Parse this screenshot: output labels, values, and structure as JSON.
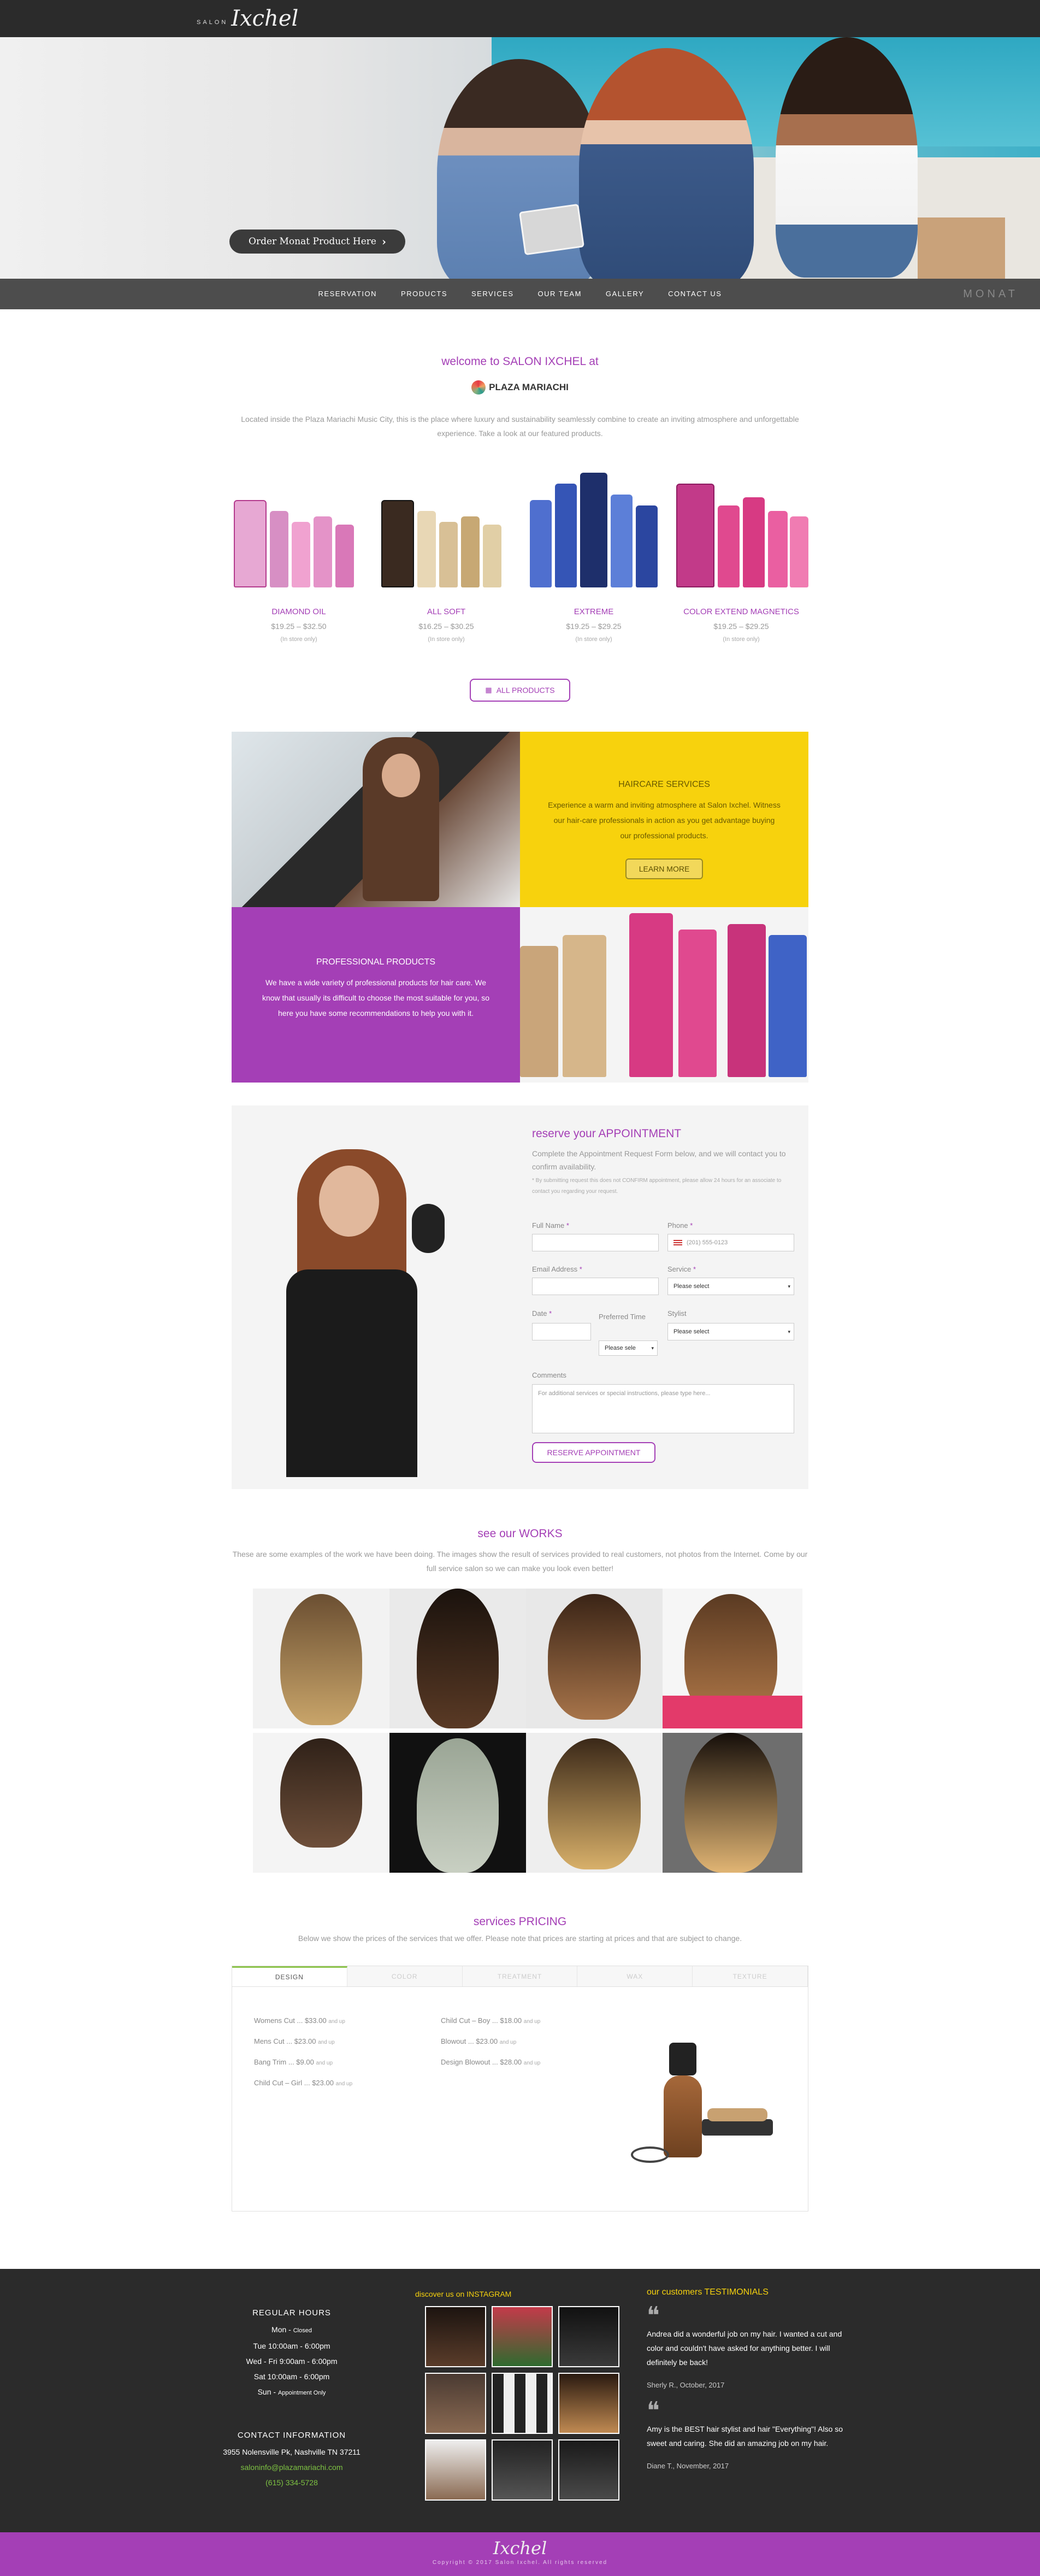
{
  "header": {
    "logo_small": "SALON",
    "logo_big": "Ixchel"
  },
  "hero": {
    "order_button": "Order Monat Product Here",
    "chevron": "›"
  },
  "nav": {
    "items": [
      "RESERVATION",
      "PRODUCTS",
      "SERVICES",
      "OUR TEAM",
      "GALLERY",
      "CONTACT US"
    ],
    "brand": "MONAT"
  },
  "welcome": {
    "title": "welcome to SALON IXCHEL at",
    "plaza": "PLAZA MARIACHI",
    "text": "Located inside the Plaza Mariachi Music City, this is the place where luxury and sustainability seamlessly combine to create an inviting atmosphere and unforgettable experience. Take a look at our featured products."
  },
  "products": [
    {
      "name": "DIAMOND OIL",
      "price": "$19.25 – $32.50",
      "note": "(In store only)"
    },
    {
      "name": "ALL SOFT",
      "price": "$16.25 – $30.25",
      "note": "(In store only)"
    },
    {
      "name": "EXTREME",
      "price": "$19.25 – $29.25",
      "note": "(In store only)"
    },
    {
      "name": "COLOR EXTEND MAGNETICS",
      "price": "$19.25 – $29.25",
      "note": "(In store only)"
    }
  ],
  "all_products_button": "ALL PRODUCTS",
  "haircare": {
    "title": "HAIRCARE SERVICES",
    "text": "Experience a warm and inviting atmosphere at Salon Ixchel. Witness our hair-care professionals in action as you get advantage buying our professional products.",
    "button": "LEARN MORE"
  },
  "professional": {
    "title": "PROFESSIONAL PRODUCTS",
    "text": "We have a wide variety of professional products for hair care. We know that usually its difficult to choose the most suitable for you, so here you have some recommendations to help you with it."
  },
  "reservation": {
    "title": "reserve your APPOINTMENT",
    "intro": "Complete the Appointment Request Form below, and we will contact you to confirm availability.",
    "fine": "* By submitting request this does not CONFIRM appointment, please allow 24 hours for an associate to contact you regarding your request.",
    "full_name_label": "Full Name",
    "phone_label": "Phone",
    "phone_placeholder": "(201) 555-0123",
    "email_label": "Email Address",
    "service_label": "Service",
    "service_value": "Please select",
    "date_label": "Date",
    "preferred_time_label": "Preferred Time",
    "time_value": "Please sele",
    "stylist_label": "Stylist",
    "stylist_value": "Please select",
    "comments_label": "Comments",
    "comments_placeholder": "For additional services or special instructions, please type here...",
    "submit": "RESERVE APPOINTMENT",
    "required_mark": "*"
  },
  "works": {
    "title": "see our WORKS",
    "text": "These are some examples of the work we have been doing. The images show the result of services provided to real customers, not photos from the Internet. Come by our full service salon so we can make you look even better!"
  },
  "pricing": {
    "title": "services PRICING",
    "subtitle": "Below we show the prices of the services that we offer. Please note that prices are starting at prices and that are subject to change.",
    "tabs": [
      "DESIGN",
      "COLOR",
      "TREATMENT",
      "WAX",
      "TEXTURE"
    ],
    "col1": [
      {
        "text": "Womens Cut ... $33.00",
        "suffix": "and up"
      },
      {
        "text": "Mens Cut ... $23.00",
        "suffix": "and up"
      },
      {
        "text": "Bang Trim ... $9.00",
        "suffix": "and up"
      },
      {
        "text": "Child Cut – Girl ... $23.00",
        "suffix": "and up"
      }
    ],
    "col2": [
      {
        "text": "Child Cut – Boy ... $18.00",
        "suffix": "and up"
      },
      {
        "text": "Blowout ... $23.00",
        "suffix": "and up"
      },
      {
        "text": "Design Blowout ... $28.00",
        "suffix": "and up"
      }
    ]
  },
  "footer": {
    "hours_title": "REGULAR HOURS",
    "hours": [
      {
        "day": "Mon -",
        "time": "Closed"
      },
      {
        "day": "Tue",
        "time": "10:00am - 6:00pm"
      },
      {
        "day": "Wed - Fri",
        "time": "9:00am - 6:00pm"
      },
      {
        "day": "Sat",
        "time": "10:00am - 6:00pm"
      },
      {
        "day": "Sun -",
        "time": "Appointment Only"
      }
    ],
    "contact_title": "CONTACT INFORMATION",
    "address": "3955 Nolensville Pk, Nashville TN 37211",
    "email": "saloninfo@plazamariachi.com",
    "phone": "(615) 334-5728",
    "instagram_title": "discover us on INSTAGRAM",
    "testimonials_title": "our customers TESTIMONIALS",
    "testimonials": [
      {
        "text": "Andrea did a wonderful job on my hair. I wanted a cut and color and couldn't have asked for anything better. I will definitely be back!",
        "by": "Sherly R., October, 2017"
      },
      {
        "text": "Amy is the BEST hair stylist and hair \"Everything\"! Also so sweet and caring. She did an amazing job on my hair.",
        "by": "Diane T., November, 2017"
      }
    ],
    "quote_mark": "❝"
  },
  "bottom": {
    "logo": "Ixchel",
    "copyright": "Copyright © 2017 Salon Ixchel. All rights reserved"
  },
  "colors": {
    "accent": "#a43fb6",
    "yellow": "#f7d20d",
    "dark": "#2b2b2b",
    "green": "#7dc242"
  }
}
